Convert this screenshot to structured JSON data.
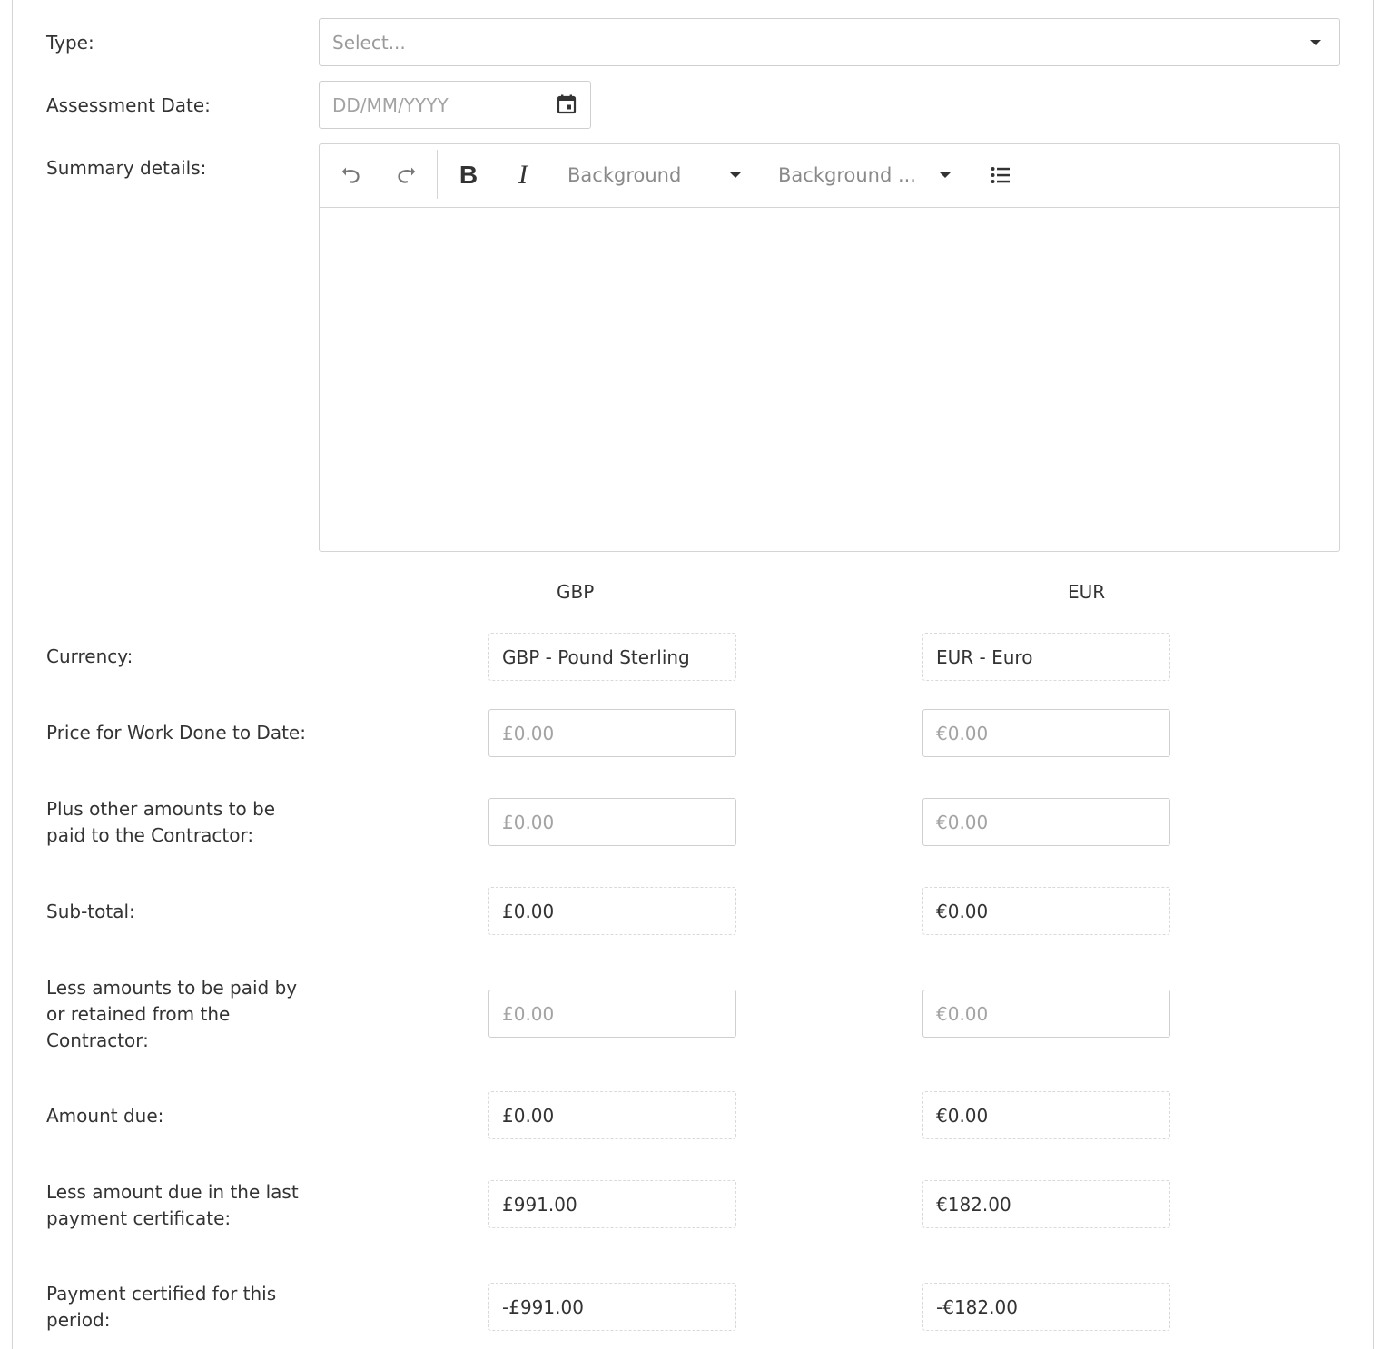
{
  "form": {
    "type_label": "Type:",
    "type_placeholder": "Select...",
    "date_label": "Assessment Date:",
    "date_placeholder": "DD/MM/YYYY",
    "summary_label": "Summary details:"
  },
  "editor_toolbar": {
    "bg_dropdown_1": "Background",
    "bg_dropdown_2": "Background ..."
  },
  "currency_headers": {
    "gbp": "GBP",
    "eur": "EUR"
  },
  "rows": {
    "currency": {
      "label": "Currency:",
      "gbp": "GBP - Pound Sterling",
      "eur": "EUR - Euro"
    },
    "price_work_done": {
      "label": "Price for Work Done to Date:",
      "gbp_placeholder": "£0.00",
      "eur_placeholder": "€0.00"
    },
    "plus_other": {
      "label_line1": "Plus other amounts to be",
      "label_line2": "paid to the Contractor:",
      "gbp_placeholder": "£0.00",
      "eur_placeholder": "€0.00"
    },
    "subtotal": {
      "label": "Sub-total:",
      "gbp": "£0.00",
      "eur": "€0.00"
    },
    "less_amounts": {
      "label_line1": "Less amounts to be paid by",
      "label_line2": "or retained from the",
      "label_line3": "Contractor:",
      "gbp_placeholder": "£0.00",
      "eur_placeholder": "€0.00"
    },
    "amount_due": {
      "label": "Amount due:",
      "gbp": "£0.00",
      "eur": "€0.00"
    },
    "less_last": {
      "label_line1": "Less amount due in the last",
      "label_line2": "payment certificate:",
      "gbp": "£991.00",
      "eur": "€182.00"
    },
    "payment_certified": {
      "label_line1": "Payment certified for this",
      "label_line2": "period:",
      "gbp": "-£991.00",
      "eur": "-€182.00"
    }
  }
}
